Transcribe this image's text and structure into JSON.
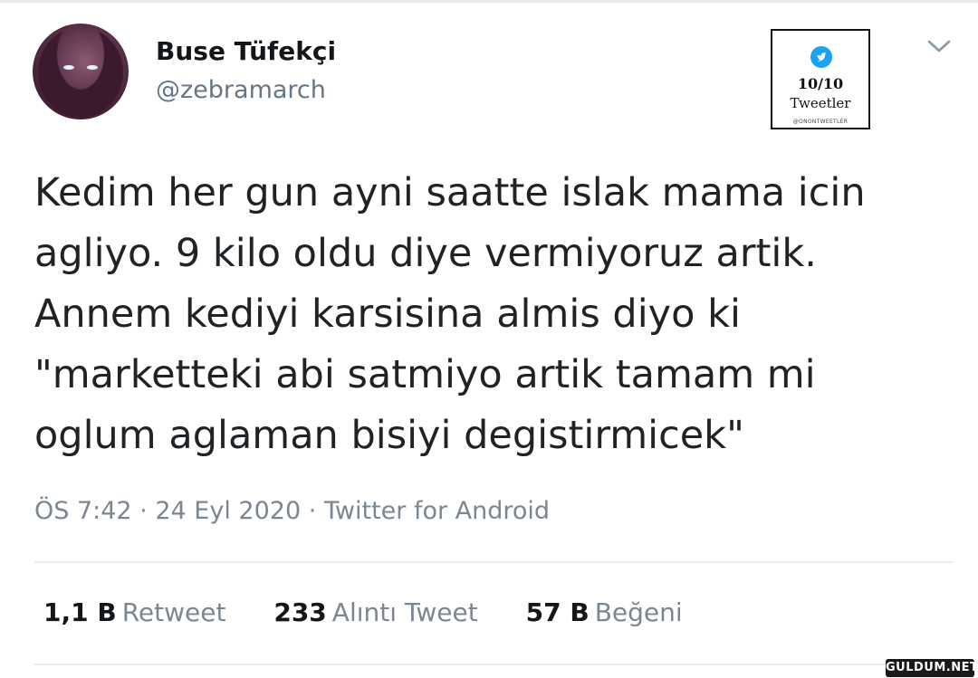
{
  "tweet": {
    "author": {
      "name": "Buse Tüfekçi",
      "handle": "@zebramarch"
    },
    "text": "Kedim her gun ayni saatte islak mama icin\nagliyo. 9 kilo oldu diye vermiyoruz artik.\nAnnem kediyi karsisina almis diyo ki\n\"marketteki abi satmiyo artik tamam mi\noglum aglaman bisiyi degistirmicek\"",
    "meta": "ÖS 7:42 · 24 Eyl 2020 · Twitter for Android",
    "stats": [
      {
        "value": "1,1 B",
        "label": "Retweet"
      },
      {
        "value": "233",
        "label": "Alıntı Tweet"
      },
      {
        "value": "57 B",
        "label": "Beğeni"
      }
    ],
    "menu_icon": "chevron-down-icon"
  },
  "badge": {
    "score": "10/10",
    "label": "Tweetler",
    "small": "@ONONTWEETLER",
    "icon": "twitter-bird-icon",
    "bird_color": "#1da1f2"
  },
  "watermark": {
    "text": "GULDUM.NET"
  },
  "colors": {
    "text": "#14171a",
    "muted": "#657786",
    "divider": "#e6ecf0"
  }
}
